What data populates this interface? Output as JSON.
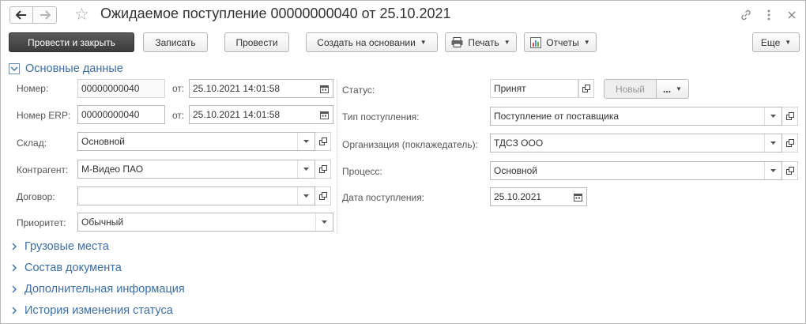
{
  "window": {
    "title": "Ожидаемое поступление 00000000040 от 25.10.2021"
  },
  "toolbar": {
    "post_close": "Провести и закрыть",
    "write": "Записать",
    "post": "Провести",
    "create_based": "Создать на основании",
    "print": "Печать",
    "reports": "Отчеты",
    "more": "Еще"
  },
  "sections": {
    "main": "Основные данные",
    "cargo": "Грузовые места",
    "composition": "Состав документа",
    "additional": "Дополнительная информация",
    "history": "История изменения статуса"
  },
  "form": {
    "number_label": "Номер:",
    "number_value": "00000000040",
    "from_label": "от:",
    "date_value": "25.10.2021 14:01:58",
    "erp_label": "Номер ERP:",
    "erp_value": "00000000040",
    "erp_from_label": "от:",
    "erp_date_value": "25.10.2021 14:01:58",
    "warehouse_label": "Склад:",
    "warehouse_value": "Основной",
    "counterparty_label": "Контрагент:",
    "counterparty_value": "М-Видео ПАО",
    "contract_label": "Договор:",
    "contract_value": "",
    "priority_label": "Приоритет:",
    "priority_value": "Обычный",
    "status_label": "Статус:",
    "status_value": "Принят",
    "status_new": "Новый",
    "status_more": "...",
    "receipt_type_label": "Тип поступления:",
    "receipt_type_value": "Поступление от поставщика",
    "organization_label": "Организация (поклажедатель):",
    "organization_value": "ТДСЗ ООО",
    "process_label": "Процесс:",
    "process_value": "Основной",
    "receipt_date_label": "Дата поступления:",
    "receipt_date_value": "25.10.2021"
  },
  "colors": {
    "section_link": "#3b6ea6",
    "primary_button": "#444444"
  }
}
